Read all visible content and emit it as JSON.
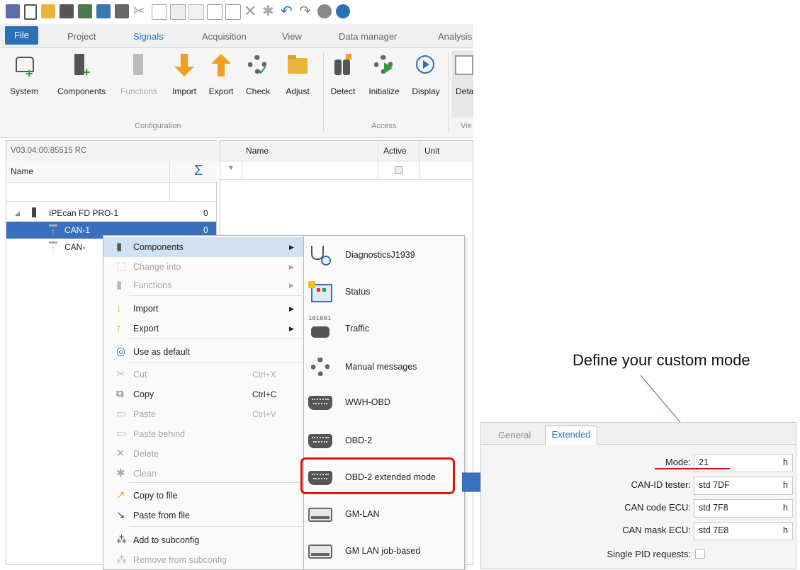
{
  "tabs": {
    "file": "File",
    "project": "Project",
    "signals": "Signals",
    "acquisition": "Acquisition",
    "view": "View",
    "data_manager": "Data manager",
    "analysis": "Analysis"
  },
  "ribbon": {
    "buttons": [
      "System",
      "Components",
      "Functions",
      "Import",
      "Export",
      "Check",
      "Adjust",
      "Detect",
      "Initialize",
      "Display",
      "Deta"
    ],
    "groups": {
      "configuration": "Configuration",
      "access": "Access",
      "view": "Vie"
    }
  },
  "tree": {
    "version": "V03.04.00.85515 RC",
    "name_header": "Name",
    "sum_symbol": "Σ",
    "rows": [
      {
        "label": "IPEcan FD PRO-1",
        "count": "0"
      },
      {
        "label": "CAN-1",
        "count": "0"
      },
      {
        "label": "CAN-",
        "count": ""
      }
    ]
  },
  "grid": {
    "col_name": "Name",
    "col_active": "Active",
    "col_unit": "Unit"
  },
  "context_menu": {
    "items": [
      {
        "label": "Components",
        "shortcut": "",
        "arrow": "▶",
        "enabled": true
      },
      {
        "label": "Change into",
        "shortcut": "",
        "arrow": "▶",
        "enabled": false
      },
      {
        "label": "Functions",
        "shortcut": "",
        "arrow": "▶",
        "enabled": false
      },
      {
        "label": "Import",
        "shortcut": "",
        "arrow": "▶",
        "enabled": true
      },
      {
        "label": "Export",
        "shortcut": "",
        "arrow": "▶",
        "enabled": true
      },
      {
        "label": "Use as default",
        "shortcut": "",
        "arrow": "",
        "enabled": true
      },
      {
        "label": "Cut",
        "shortcut": "Ctrl+X",
        "arrow": "",
        "enabled": false
      },
      {
        "label": "Copy",
        "shortcut": "Ctrl+C",
        "arrow": "",
        "enabled": true
      },
      {
        "label": "Paste",
        "shortcut": "Ctrl+V",
        "arrow": "",
        "enabled": false
      },
      {
        "label": "Paste behind",
        "shortcut": "",
        "arrow": "",
        "enabled": false
      },
      {
        "label": "Delete",
        "shortcut": "",
        "arrow": "",
        "enabled": false
      },
      {
        "label": "Clean",
        "shortcut": "",
        "arrow": "",
        "enabled": false
      },
      {
        "label": "Copy to file",
        "shortcut": "",
        "arrow": "",
        "enabled": true
      },
      {
        "label": "Paste from file",
        "shortcut": "",
        "arrow": "",
        "enabled": true
      },
      {
        "label": "Add to subconfig",
        "shortcut": "",
        "arrow": "",
        "enabled": true
      },
      {
        "label": "Remove from subconfig",
        "shortcut": "",
        "arrow": "",
        "enabled": false
      }
    ]
  },
  "submenu": {
    "items": [
      "DiagnosticsJ1939",
      "Status",
      "Traffic",
      "Manual messages",
      "WWH-OBD",
      "OBD-2",
      "OBD-2 extended mode",
      "GM-LAN",
      "GM LAN job-based"
    ],
    "traffic_icon_text": "101001"
  },
  "callout": "Define your custom mode",
  "properties": {
    "tabs": {
      "general": "General",
      "extended": "Extended"
    },
    "fields": [
      {
        "label": "Mode:",
        "value": "21",
        "unit": "h"
      },
      {
        "label": "CAN-ID tester:",
        "value": "std  7DF",
        "unit": "h"
      },
      {
        "label": "CAN code ECU:",
        "value": "std  7F8",
        "unit": "h"
      },
      {
        "label": "CAN mask ECU:",
        "value": "std  7E8",
        "unit": "h"
      }
    ],
    "single_pid_label": "Single PID requests:",
    "single_pid_checked": false
  },
  "colors": {
    "accent": "#2b71b8",
    "highlight_red": "#e01414",
    "selection": "#3a6fc0",
    "menu_hover": "#cfe1f3"
  }
}
